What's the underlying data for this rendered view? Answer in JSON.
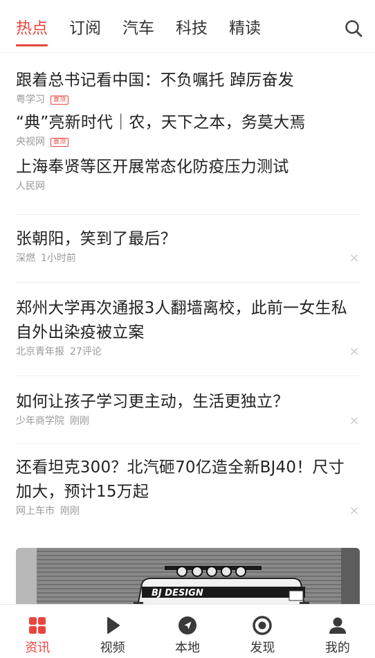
{
  "tabs": [
    "热点",
    "订阅",
    "汽车",
    "科技",
    "精读"
  ],
  "articles": [
    {
      "title": "跟着总书记看中国：不负嘱托 踔厉奋发",
      "source": "粤学习",
      "pin": "置顶"
    },
    {
      "title": "“典”亮新时代｜农，天下之本，务莫大焉",
      "source": "央视网",
      "pin": "置顶"
    },
    {
      "title": "上海奉贤等区开展常态化防疫压力测试",
      "source": "人民网"
    },
    {
      "title": "张朝阳，笑到了最后？",
      "source": "深燃",
      "time": "1小时前"
    },
    {
      "title": "郑州大学再次通报3人翻墙离校，此前一女生私自外出染疫被立案",
      "source": "北京青年报",
      "time": "27评论"
    },
    {
      "title": "如何让孩子学习更主动，生活更独立？",
      "source": "少年商学院",
      "time": "刚刚"
    },
    {
      "title": "还看坦克300？北汽砸70亿造全新BJ40！尺寸加大，预计15万起",
      "source": "网上车市",
      "time": "刚刚"
    }
  ],
  "photo_text": "BJ DESIGN",
  "close_icon": "×",
  "bottom_nav": [
    {
      "label": "资讯",
      "icon": "grid-icon"
    },
    {
      "label": "视频",
      "icon": "play-icon"
    },
    {
      "label": "本地",
      "icon": "location-icon"
    },
    {
      "label": "发现",
      "icon": "target-icon"
    },
    {
      "label": "我的",
      "icon": "user-icon"
    }
  ],
  "colors": {
    "accent": "#e8453c",
    "text": "#222222",
    "meta": "#999999"
  }
}
